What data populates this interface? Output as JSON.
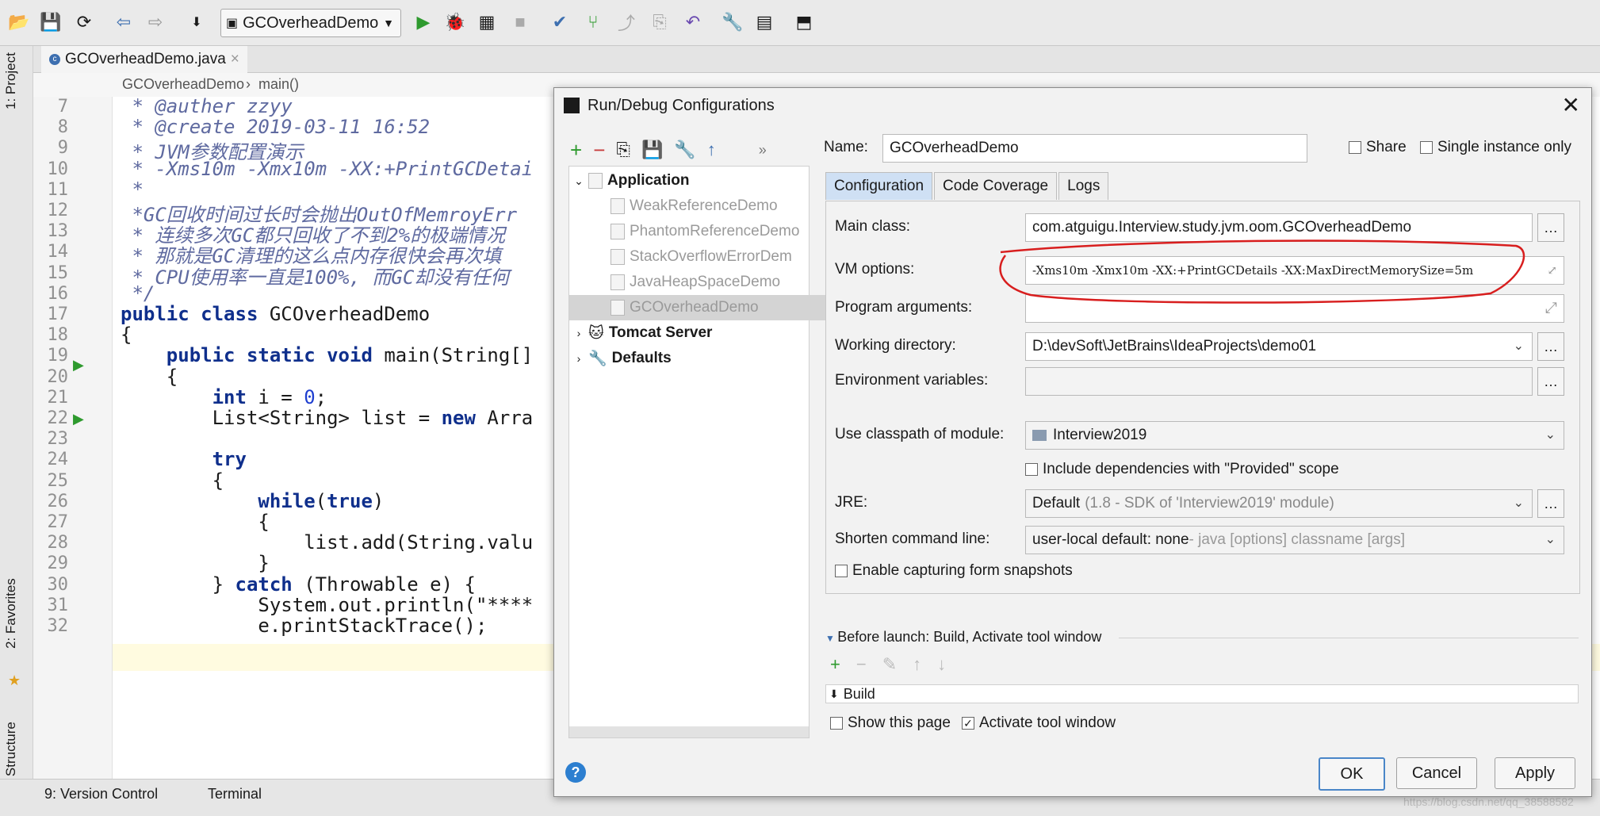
{
  "toolbar": {
    "run_config": "GCOverheadDemo"
  },
  "left_strip": {
    "project": "1: Project",
    "favorites": "2: Favorites",
    "structure": "7: Structure"
  },
  "editor": {
    "file_tab": "GCOverheadDemo.java",
    "breadcrumb": [
      "GCOverheadDemo",
      "main()"
    ],
    "lines": [
      {
        "n": "7",
        "t": " * @auther zzyy"
      },
      {
        "n": "8",
        "t": " * @create 2019-03-11 16:52"
      },
      {
        "n": "9",
        "t": " * JVM参数配置演示"
      },
      {
        "n": "10",
        "t": " * -Xms10m -Xmx10m -XX:+PrintGCDetai"
      },
      {
        "n": "11",
        "t": " *"
      },
      {
        "n": "12",
        "t": " *GC回收时间过长时会抛出OutOfMemroyErr"
      },
      {
        "n": "13",
        "t": " * 连续多次GC都只回收了不到2%的极端情况"
      },
      {
        "n": "14",
        "t": " * 那就是GC清理的这么点内存很快会再次填"
      },
      {
        "n": "15",
        "t": " * CPU使用率一直是100%, 而GC却没有任何"
      },
      {
        "n": "16",
        "t": " */"
      },
      {
        "n": "17",
        "t": "public class GCOverheadDemo"
      },
      {
        "n": "18",
        "t": "{"
      },
      {
        "n": "19",
        "t": "    public static void main(String[]"
      },
      {
        "n": "20",
        "t": "    {"
      },
      {
        "n": "21",
        "t": "        int i = 0;"
      },
      {
        "n": "22",
        "t": "        List<String> list = new Arra"
      },
      {
        "n": "23",
        "t": ""
      },
      {
        "n": "24",
        "t": "        try"
      },
      {
        "n": "25",
        "t": "        {"
      },
      {
        "n": "26",
        "t": "            while(true)"
      },
      {
        "n": "27",
        "t": "            {"
      },
      {
        "n": "28",
        "t": "                list.add(String.valu"
      },
      {
        "n": "29",
        "t": "            }"
      },
      {
        "n": "30",
        "t": "        } catch (Throwable e) {"
      },
      {
        "n": "31",
        "t": "            System.out.println(\"****"
      },
      {
        "n": "32",
        "t": "            e.printStackTrace();"
      }
    ]
  },
  "statusbar": {
    "version_control": "9: Version Control",
    "terminal": "Terminal",
    "watermark": "https://blog.csdn.net/qq_38588582"
  },
  "dialog": {
    "title": "Run/Debug Configurations",
    "name_label": "Name:",
    "name_value": "GCOverheadDemo",
    "share_label": "Share",
    "single_instance_label": "Single instance only",
    "tree": {
      "application": "Application",
      "children": [
        "WeakReferenceDemo",
        "PhantomReferenceDemo",
        "StackOverflowErrorDem",
        "JavaHeapSpaceDemo",
        "GCOverheadDemo"
      ],
      "tomcat": "Tomcat Server",
      "defaults": "Defaults"
    },
    "tabs": [
      "Configuration",
      "Code Coverage",
      "Logs"
    ],
    "fields": {
      "main_class_label": "Main class:",
      "main_class": "com.atguigu.Interview.study.jvm.oom.GCOverheadDemo",
      "vm_options_label": "VM options:",
      "vm_options": "-Xms10m -Xmx10m -XX:+PrintGCDetails -XX:MaxDirectMemorySize=5m",
      "program_args_label": "Program arguments:",
      "program_args": "",
      "working_dir_label": "Working directory:",
      "working_dir": "D:\\devSoft\\JetBrains\\IdeaProjects\\demo01",
      "env_vars_label": "Environment variables:",
      "env_vars": "",
      "classpath_label": "Use classpath of module:",
      "classpath_module": "Interview2019",
      "include_deps_label": "Include dependencies with \"Provided\" scope",
      "jre_label": "JRE:",
      "jre_main": "Default",
      "jre_detail": "(1.8 - SDK of 'Interview2019' module)",
      "shorten_label": "Shorten command line:",
      "shorten_main": "user-local default: none",
      "shorten_detail": " - java [options] classname [args]",
      "form_snapshots_label": "Enable capturing form snapshots"
    },
    "before_launch": {
      "header": "Before launch: Build, Activate tool window",
      "item": "Build",
      "show_page": "Show this page",
      "activate_tool": "Activate tool window"
    },
    "buttons": {
      "ok": "OK",
      "cancel": "Cancel",
      "apply": "Apply",
      "help": "?"
    }
  },
  "colors": {
    "annotation_red": "#d81e1e",
    "accent_blue": "#4a86c8",
    "run_green": "#2e9a2e"
  }
}
